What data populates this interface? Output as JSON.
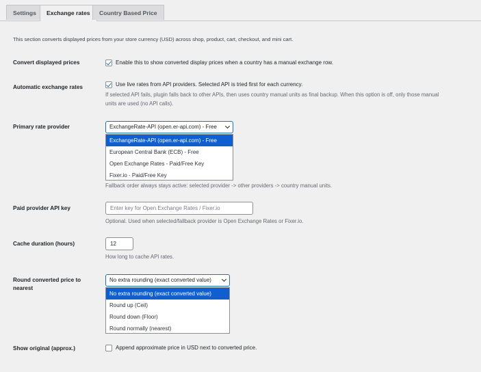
{
  "tabs": [
    {
      "label": "Settings",
      "active": false
    },
    {
      "label": "Exchange rates",
      "active": true
    },
    {
      "label": "Country Based Price",
      "active": false
    }
  ],
  "intro": "This section converts displayed prices from your store currency (USD) across shop, product, cart, checkout, and mini cart.",
  "convert": {
    "label": "Convert displayed prices",
    "checked": true,
    "text": "Enable this to show converted display prices when a country has a manual exchange row."
  },
  "auto": {
    "label": "Automatic exchange rates",
    "checked": true,
    "text": "Use live rates from API providers. Selected API is tried first for each currency.",
    "desc1": "If selected API fails, plugin falls back to other APIs, then uses country manual units as final backup. When this option is off, only those manual",
    "desc2": "units are used (no API calls)."
  },
  "provider": {
    "label": "Primary rate provider",
    "selected": "ExchangeRate-API (open.er-api.com) - Free",
    "options": [
      "ExchangeRate-API (open.er-api.com) - Free",
      "European Central Bank (ECB) - Free",
      "Open Exchange Rates - Paid/Free Key",
      "Fixer.io - Paid/Free Key"
    ],
    "desc": "Fallback order always stays active: selected provider -> other providers -> country manual units."
  },
  "apikey": {
    "label": "Paid provider API key",
    "value": "",
    "placeholder": "Enter key for Open Exchange Rates / Fixer.io",
    "desc": "Optional. Used when selected/fallback provider is Open Exchange Rates or Fixer.io."
  },
  "cache": {
    "label": "Cache duration (hours)",
    "value": "12",
    "desc": "How long to cache API rates."
  },
  "rounding": {
    "label1": "Round converted price to",
    "label2": "nearest",
    "selected": "No extra rounding (exact converted value)",
    "options": [
      "No extra rounding (exact converted value)",
      "Round up (Ceil)",
      "Round down (Floor)",
      "Round normally (nearest)"
    ]
  },
  "original": {
    "label": "Show original (approx.)",
    "checked": false,
    "text": "Append approximate price in USD next to converted price."
  }
}
